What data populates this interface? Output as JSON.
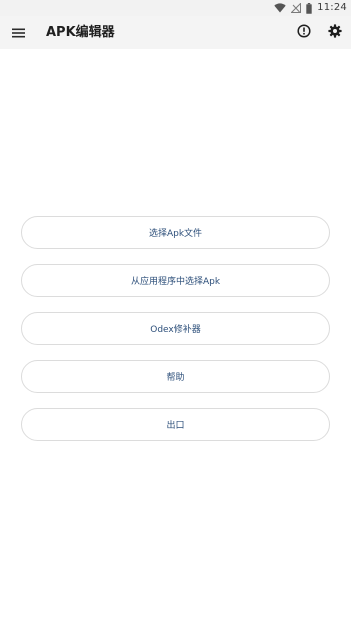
{
  "status_bar": {
    "time": "11:24",
    "icons": [
      "wifi-icon",
      "no-signal-icon",
      "battery-icon"
    ]
  },
  "app_bar": {
    "title": "APK编辑器",
    "menu_icon": "hamburger-menu-icon",
    "about_icon": "info-icon",
    "settings_icon": "gear-icon"
  },
  "actions": [
    {
      "label": "选择Apk文件"
    },
    {
      "label": "从应用程序中选择Apk"
    },
    {
      "label": "Odex修补器"
    },
    {
      "label": "帮助"
    },
    {
      "label": "出口"
    }
  ],
  "colors": {
    "button_text": "#2d4f7a",
    "button_border": "#dcdcdc",
    "app_bar_bg": "#f4f4f4",
    "status_bar_bg": "#f2f2f2"
  }
}
